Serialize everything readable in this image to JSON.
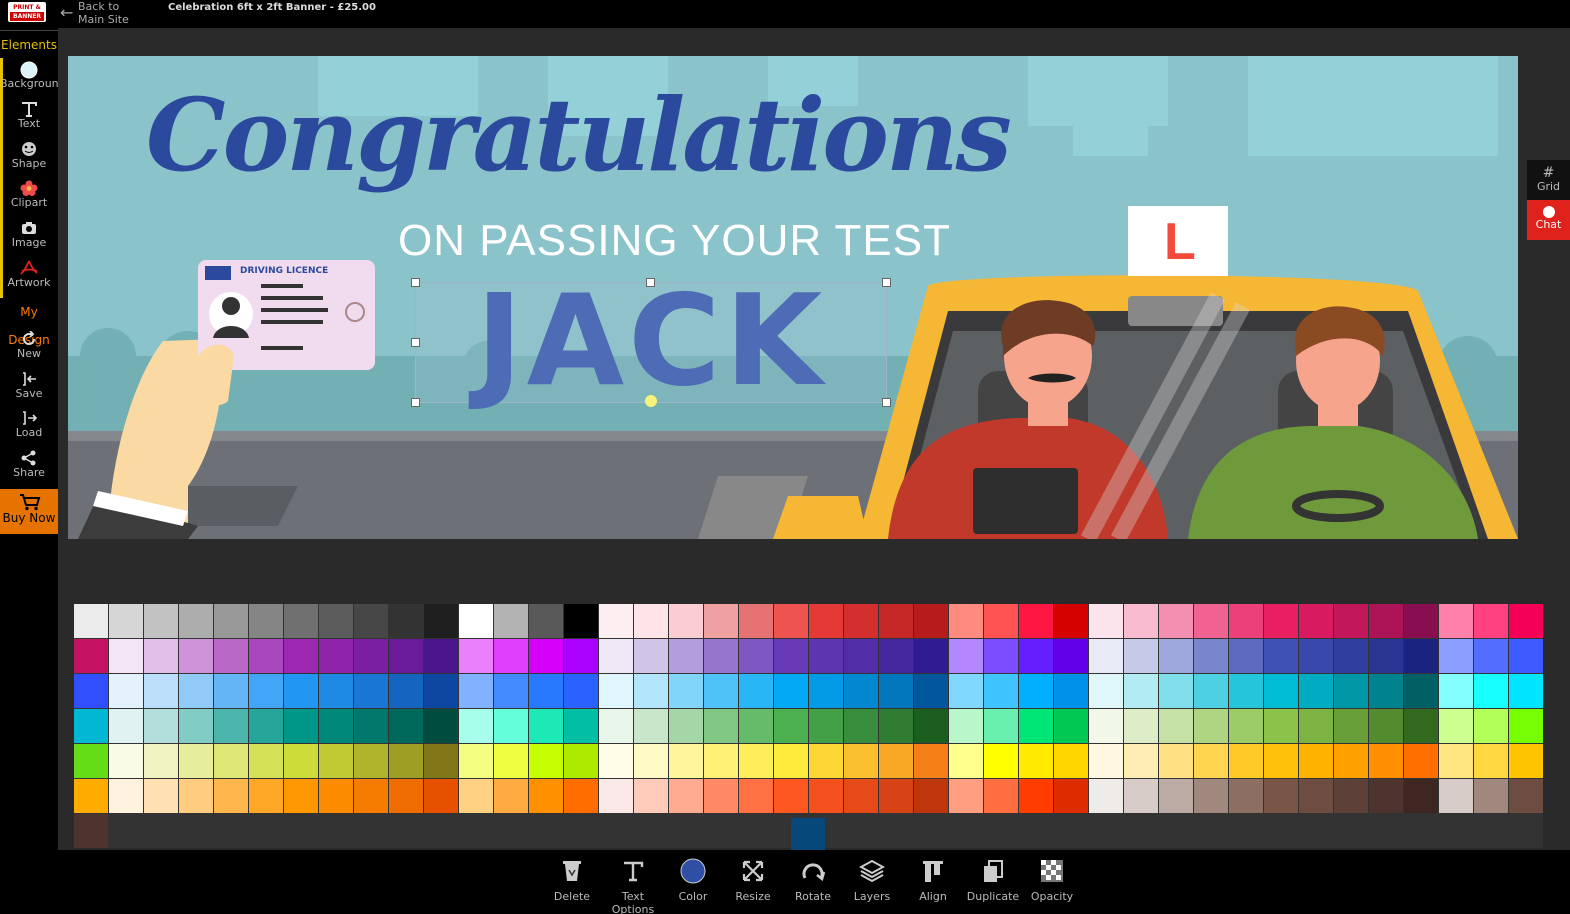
{
  "header": {
    "logo_top": "PRINT &",
    "logo_bottom": "BANNER",
    "back_label": "Back to Main Site",
    "title": "Celebration 6ft x 2ft Banner - £25.00"
  },
  "sidebar": {
    "elements_header": "Elements",
    "elements": [
      {
        "label": "Background",
        "icon": "circle-icon"
      },
      {
        "label": "Text",
        "icon": "text-icon"
      },
      {
        "label": "Shape",
        "icon": "shape-icon"
      },
      {
        "label": "Clipart",
        "icon": "clipart-icon"
      },
      {
        "label": "Image",
        "icon": "camera-icon"
      },
      {
        "label": "Artwork",
        "icon": "pdf-icon"
      }
    ],
    "mydesign_header": "My Design",
    "mydesign": [
      {
        "label": "New",
        "icon": "refresh-icon"
      },
      {
        "label": "Save",
        "icon": "save-icon"
      },
      {
        "label": "Load",
        "icon": "load-icon"
      },
      {
        "label": "Share",
        "icon": "share-icon"
      }
    ],
    "buy_now": "Buy Now"
  },
  "right_rail": {
    "grid_label": "Grid",
    "chat_label": "Chat"
  },
  "banner": {
    "headline": "Congratulations",
    "subline": "ON PASSING YOUR TEST",
    "name": "JACK",
    "licence_label": "DRIVING LICENCE",
    "learner_plate": "L"
  },
  "toolbar": {
    "items": [
      {
        "label": "Delete",
        "icon": "recycle-icon"
      },
      {
        "label": "Text Options",
        "icon": "text-options-icon"
      },
      {
        "label": "Color",
        "icon": "color-icon"
      },
      {
        "label": "Resize",
        "icon": "resize-icon"
      },
      {
        "label": "Rotate",
        "icon": "rotate-icon"
      },
      {
        "label": "Layers",
        "icon": "layers-icon"
      },
      {
        "label": "Align",
        "icon": "align-icon"
      },
      {
        "label": "Duplicate",
        "icon": "duplicate-icon"
      },
      {
        "label": "Opacity",
        "icon": "opacity-icon"
      }
    ]
  },
  "colors": {
    "accent_yellow": "#e6c200",
    "accent_orange": "#e67300",
    "chat_red": "#e0221c",
    "selected_color": "#06487a",
    "palette": [
      [
        "#ebebeb",
        "#d6d6d6",
        "#c2c2c2",
        "#adadad",
        "#999999",
        "#858585",
        "#707070",
        "#5c5c5c",
        "#474747",
        "#333333",
        "#1f1f1f",
        "#ffffff",
        "#b3b3b3",
        "#595959",
        "#000000",
        "#fdeef2",
        "#fde4e8",
        "#fbcdd3",
        "#efa0a0",
        "#e57373",
        "#ef5350",
        "#e53935",
        "#d32f2f",
        "#c62828",
        "#b71c1c",
        "#ff8a80",
        "#ff5252",
        "#ff1744",
        "#d50000",
        "#fce4ec",
        "#f8bbd0",
        "#f48fb1",
        "#f06292",
        "#ec407a",
        "#e91e63",
        "#d81b60",
        "#c2185b",
        "#ad1457",
        "#880e4f",
        "#ff80ab",
        "#ff4081",
        "#f50057",
        "#c51162"
      ],
      [
        "#f3e5f5",
        "#e1bee7",
        "#ce93d8",
        "#ba68c8",
        "#ab47bc",
        "#9c27b0",
        "#8e24aa",
        "#7b1fa2",
        "#6a1b9a",
        "#4a148c",
        "#ea80fc",
        "#e040fb",
        "#d500f9",
        "#aa00ff",
        "#ede7f6",
        "#d1c4e9",
        "#b39ddb",
        "#9575cd",
        "#7e57c2",
        "#673ab7",
        "#5e35b1",
        "#512da8",
        "#4527a0",
        "#311b92",
        "#b388ff",
        "#7c4dff",
        "#651fff",
        "#6200ea",
        "#e8eaf6",
        "#c5cae9",
        "#9fa8da",
        "#7986cb",
        "#5c6bc0",
        "#3f51b5",
        "#3949ab",
        "#303f9f",
        "#283593",
        "#1a237e",
        "#8c9eff",
        "#536dfe",
        "#3d5afe",
        "#304ffe"
      ],
      [
        "#e3f2fd",
        "#bbdefb",
        "#90caf9",
        "#64b5f6",
        "#42a5f5",
        "#2196f3",
        "#1e88e5",
        "#1976d2",
        "#1565c0",
        "#0d47a1",
        "#82b1ff",
        "#448aff",
        "#2979ff",
        "#2962ff",
        "#e1f5fe",
        "#b3e5fc",
        "#81d4fa",
        "#4fc3f7",
        "#29b6f6",
        "#03a9f4",
        "#039be5",
        "#0288d1",
        "#0277bd",
        "#01579b",
        "#80d8ff",
        "#40c4ff",
        "#00b0ff",
        "#0091ea",
        "#e0f7fa",
        "#b2ebf2",
        "#80deea",
        "#4dd0e1",
        "#26c6da",
        "#00bcd4",
        "#00acc1",
        "#0097a7",
        "#00838f",
        "#006064",
        "#84ffff",
        "#18ffff",
        "#00e5ff",
        "#00b8d4"
      ],
      [
        "#e0f2f1",
        "#b2dfdb",
        "#80cbc4",
        "#4db6ac",
        "#26a69a",
        "#009688",
        "#00897b",
        "#00796b",
        "#00695c",
        "#004d40",
        "#a7ffeb",
        "#64ffda",
        "#1de9b6",
        "#00bfa5",
        "#e8f5e9",
        "#c8e6c9",
        "#a5d6a7",
        "#81c784",
        "#66bb6a",
        "#4caf50",
        "#43a047",
        "#388e3c",
        "#2e7d32",
        "#1b5e20",
        "#b9f6ca",
        "#69f0ae",
        "#00e676",
        "#00c853",
        "#f1f8e9",
        "#dcedc8",
        "#c5e1a5",
        "#aed581",
        "#9ccc65",
        "#8bc34a",
        "#7cb342",
        "#689f38",
        "#558b2f",
        "#33691e",
        "#ccff90",
        "#b2ff59",
        "#76ff03",
        "#64dd17"
      ],
      [
        "#f9fbe7",
        "#f0f4c3",
        "#e6ee9c",
        "#dce775",
        "#d4e157",
        "#cddc39",
        "#c0ca33",
        "#afb42b",
        "#9e9d24",
        "#827717",
        "#f4ff81",
        "#eeff41",
        "#c6ff00",
        "#aeea00",
        "#fffde7",
        "#fff9c4",
        "#fff59d",
        "#fff176",
        "#ffee58",
        "#ffeb3b",
        "#fdd835",
        "#fbc02d",
        "#f9a825",
        "#f57f17",
        "#ffff8d",
        "#ffff00",
        "#ffea00",
        "#ffd600",
        "#fff8e1",
        "#ffecb3",
        "#ffe082",
        "#ffd54f",
        "#ffca28",
        "#ffc107",
        "#ffb300",
        "#ffa000",
        "#ff8f00",
        "#ff6f00",
        "#ffe57f",
        "#ffd740",
        "#ffc400",
        "#ffab00"
      ],
      [
        "#fff3e0",
        "#ffe0b2",
        "#ffcc80",
        "#ffb74d",
        "#ffa726",
        "#ff9800",
        "#fb8c00",
        "#f57c00",
        "#ef6c00",
        "#e65100",
        "#ffd180",
        "#ffab40",
        "#ff9100",
        "#ff6d00",
        "#fbe9e7",
        "#ffccbc",
        "#ffab91",
        "#ff8a65",
        "#ff7043",
        "#ff5722",
        "#f4511e",
        "#e64a19",
        "#d84315",
        "#bf360c",
        "#ff9e80",
        "#ff6e40",
        "#ff3d00",
        "#dd2c00",
        "#efebe9",
        "#d7ccc8",
        "#bcaaa4",
        "#a1887f",
        "#8d6e63",
        "#795548",
        "#6d4c41",
        "#5d4037",
        "#4e342e",
        "#3e2723",
        "#d7ccc8",
        "#a1887f",
        "#6d4c41",
        "#4e342e"
      ]
    ]
  }
}
